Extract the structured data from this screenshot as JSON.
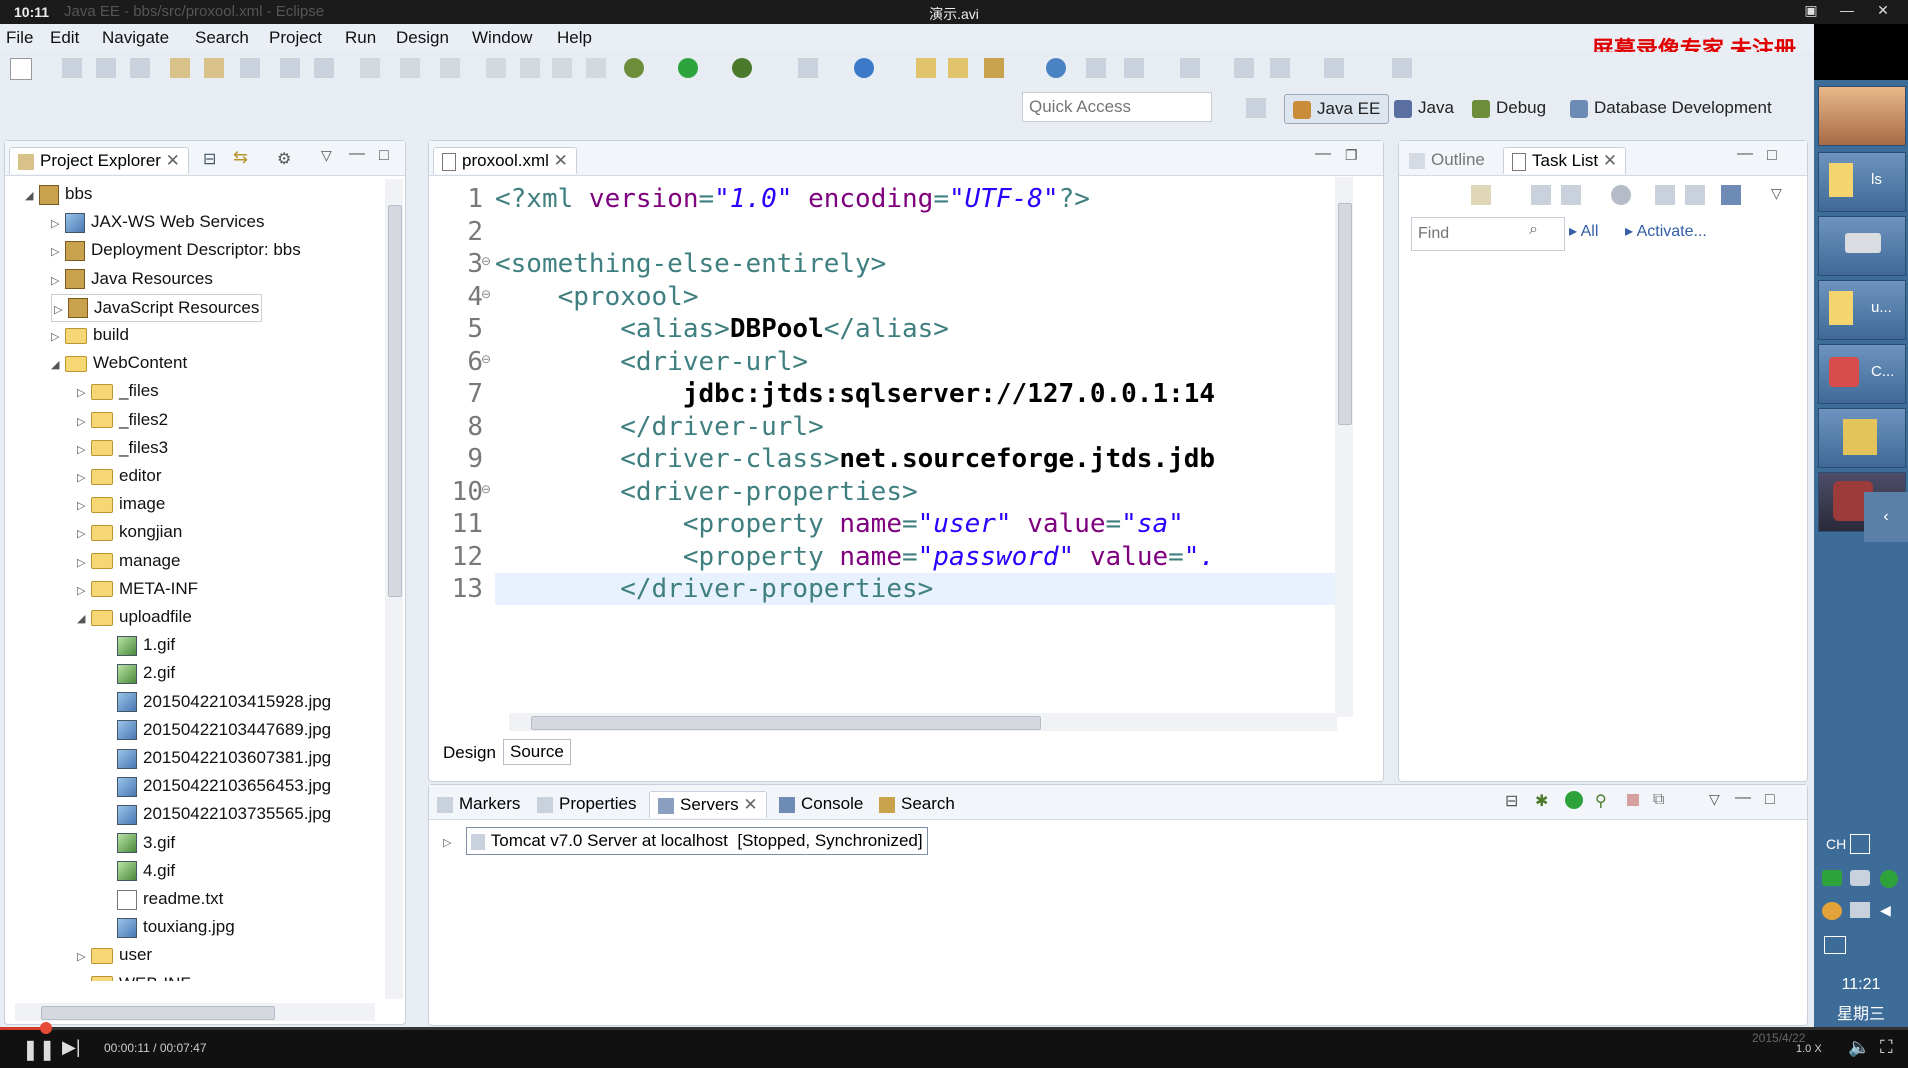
{
  "player": {
    "clock": "10:11",
    "faded_title": "Java EE - bbs/src/proxool.xml - Eclipse",
    "video_title": "演示.avi",
    "elapsed": "00:00:11",
    "total": "00:07:47",
    "time_display": "00:00:11 / 00:07:47",
    "speed": "1.0 X",
    "progress_fraction": 0.024
  },
  "watermark": "屏幕录像专家 未注册",
  "menu": [
    "File",
    "Edit",
    "Navigate",
    "Search",
    "Project",
    "Run",
    "Design",
    "Window",
    "Help"
  ],
  "quick_access": {
    "placeholder": "Quick Access"
  },
  "perspectives": [
    "Java EE",
    "Java",
    "Debug",
    "Database Development"
  ],
  "project_explorer": {
    "title": "Project Explorer",
    "tree": [
      {
        "label": "bbs",
        "depth": 0,
        "twisty": "open",
        "icon": "project-icon"
      },
      {
        "label": "JAX-WS Web Services",
        "depth": 1,
        "twisty": "closed",
        "icon": "webservice-icon"
      },
      {
        "label": "Deployment Descriptor: bbs",
        "depth": 1,
        "twisty": "closed",
        "icon": "descriptor-icon"
      },
      {
        "label": "Java Resources",
        "depth": 1,
        "twisty": "closed",
        "icon": "java-resources-icon"
      },
      {
        "label": "JavaScript Resources",
        "depth": 1,
        "twisty": "closed",
        "icon": "js-resources-icon"
      },
      {
        "label": "build",
        "depth": 1,
        "twisty": "closed",
        "icon": "folder-icon"
      },
      {
        "label": "WebContent",
        "depth": 1,
        "twisty": "open",
        "icon": "folder-icon"
      },
      {
        "label": "_files",
        "depth": 2,
        "twisty": "closed",
        "icon": "folder-icon"
      },
      {
        "label": "_files2",
        "depth": 2,
        "twisty": "closed",
        "icon": "folder-icon"
      },
      {
        "label": "_files3",
        "depth": 2,
        "twisty": "closed",
        "icon": "folder-icon"
      },
      {
        "label": "editor",
        "depth": 2,
        "twisty": "closed",
        "icon": "folder-icon"
      },
      {
        "label": "image",
        "depth": 2,
        "twisty": "closed",
        "icon": "folder-icon"
      },
      {
        "label": "kongjian",
        "depth": 2,
        "twisty": "closed",
        "icon": "folder-icon"
      },
      {
        "label": "manage",
        "depth": 2,
        "twisty": "closed",
        "icon": "folder-icon"
      },
      {
        "label": "META-INF",
        "depth": 2,
        "twisty": "closed",
        "icon": "folder-icon"
      },
      {
        "label": "uploadfile",
        "depth": 2,
        "twisty": "open",
        "icon": "folder-icon"
      },
      {
        "label": "1.gif",
        "depth": 3,
        "twisty": "none",
        "icon": "gif-file-icon"
      },
      {
        "label": "2.gif",
        "depth": 3,
        "twisty": "none",
        "icon": "gif-file-icon"
      },
      {
        "label": "20150422103415928.jpg",
        "depth": 3,
        "twisty": "none",
        "icon": "jpg-file-icon"
      },
      {
        "label": "20150422103447689.jpg",
        "depth": 3,
        "twisty": "none",
        "icon": "jpg-file-icon"
      },
      {
        "label": "20150422103607381.jpg",
        "depth": 3,
        "twisty": "none",
        "icon": "jpg-file-icon"
      },
      {
        "label": "20150422103656453.jpg",
        "depth": 3,
        "twisty": "none",
        "icon": "jpg-file-icon"
      },
      {
        "label": "20150422103735565.jpg",
        "depth": 3,
        "twisty": "none",
        "icon": "jpg-file-icon"
      },
      {
        "label": "3.gif",
        "depth": 3,
        "twisty": "none",
        "icon": "gif-file-icon"
      },
      {
        "label": "4.gif",
        "depth": 3,
        "twisty": "none",
        "icon": "gif-file-icon"
      },
      {
        "label": "readme.txt",
        "depth": 3,
        "twisty": "none",
        "icon": "txt-file-icon"
      },
      {
        "label": "touxiang.jpg",
        "depth": 3,
        "twisty": "none",
        "icon": "jpg-file-icon"
      },
      {
        "label": "user",
        "depth": 2,
        "twisty": "closed",
        "icon": "folder-icon"
      },
      {
        "label": "WEB-INF",
        "depth": 2,
        "twisty": "closed",
        "icon": "folder-icon"
      }
    ]
  },
  "editor": {
    "tab": "proxool.xml",
    "bottom_tabs": [
      "Design",
      "Source"
    ],
    "active_bottom_tab": "Source",
    "lines": [
      {
        "n": "1",
        "fold": "",
        "segs": [
          [
            "pi",
            "<?xml "
          ],
          [
            "attr",
            "version"
          ],
          [
            "pi",
            "="
          ],
          [
            "str",
            "\"1.0\""
          ],
          [
            "pi",
            " "
          ],
          [
            "attr",
            "encoding"
          ],
          [
            "pi",
            "="
          ],
          [
            "str",
            "\"UTF-8\""
          ],
          [
            "pi",
            "?>"
          ]
        ]
      },
      {
        "n": "2",
        "fold": "",
        "segs": []
      },
      {
        "n": "3",
        "fold": "⊖",
        "segs": [
          [
            "tag",
            "<something-else-entirely>"
          ]
        ]
      },
      {
        "n": "4",
        "fold": "⊖",
        "segs": [
          [
            "tag",
            "    <proxool>"
          ]
        ]
      },
      {
        "n": "5",
        "fold": "",
        "segs": [
          [
            "tag",
            "        <alias>"
          ],
          [
            "txt",
            "DBPool"
          ],
          [
            "tag",
            "</alias>"
          ]
        ]
      },
      {
        "n": "6",
        "fold": "⊖",
        "segs": [
          [
            "tag",
            "        <driver-url>"
          ]
        ]
      },
      {
        "n": "7",
        "fold": "",
        "segs": [
          [
            "txt",
            "            jdbc:jtds:sqlserver://127.0.0.1:14"
          ]
        ]
      },
      {
        "n": "8",
        "fold": "",
        "segs": [
          [
            "tag",
            "        </driver-url>"
          ]
        ]
      },
      {
        "n": "9",
        "fold": "",
        "segs": [
          [
            "tag",
            "        <driver-class>"
          ],
          [
            "txt",
            "net.sourceforge.jtds.jdb"
          ]
        ]
      },
      {
        "n": "10",
        "fold": "⊖",
        "segs": [
          [
            "tag",
            "        <driver-properties>"
          ]
        ]
      },
      {
        "n": "11",
        "fold": "",
        "segs": [
          [
            "tag",
            "            <property "
          ],
          [
            "attr",
            "name"
          ],
          [
            "pi",
            "="
          ],
          [
            "str",
            "\"user\""
          ],
          [
            "pi",
            " "
          ],
          [
            "attr",
            "value"
          ],
          [
            "pi",
            "="
          ],
          [
            "str",
            "\"sa\""
          ]
        ]
      },
      {
        "n": "12",
        "fold": "",
        "segs": [
          [
            "tag",
            "            <property "
          ],
          [
            "attr",
            "name"
          ],
          [
            "pi",
            "="
          ],
          [
            "str",
            "\"password\""
          ],
          [
            "pi",
            " "
          ],
          [
            "attr",
            "value"
          ],
          [
            "pi",
            "="
          ],
          [
            "str",
            "\"."
          ]
        ]
      },
      {
        "n": "13",
        "fold": "",
        "segs": [
          [
            "tag",
            "        </driver-properties>"
          ]
        ]
      }
    ]
  },
  "right_panel": {
    "tabs": [
      "Outline",
      "Task List"
    ],
    "find_placeholder": "Find",
    "all_label": "All",
    "activate_label": "Activate..."
  },
  "bottom_panel": {
    "tabs": [
      "Markers",
      "Properties",
      "Servers",
      "Console",
      "Search"
    ],
    "active_tab": "Servers",
    "server": "Tomcat v7.0 Server at localhost  [Stopped, Synchronized]"
  },
  "desktop_strip": {
    "items": [
      "ls",
      "u...",
      "C..."
    ],
    "ime": "CH",
    "time": "11:21",
    "weekday": "星期三",
    "date": "2015/4/22"
  }
}
